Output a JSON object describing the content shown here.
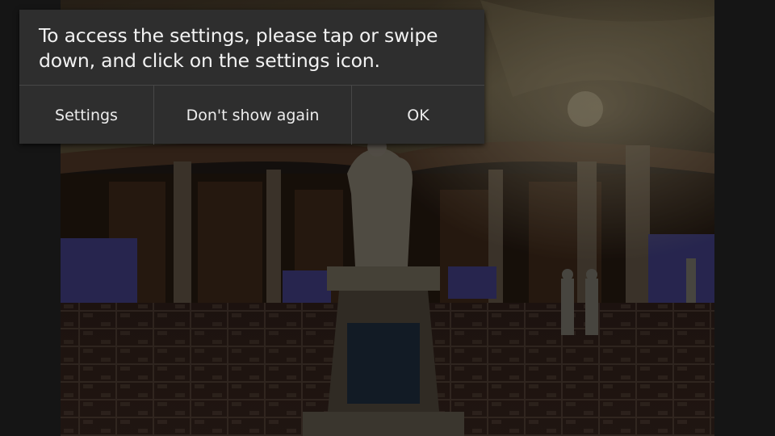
{
  "dialog": {
    "message": "To access the settings, please tap or swipe down, and click on the settings icon.",
    "buttons": {
      "settings": "Settings",
      "dont_show": "Don't show again",
      "ok": "OK"
    }
  },
  "colors": {
    "dialog_bg": "#2e2e2e",
    "divider": "#474747",
    "text": "#f2f2f2",
    "backdrop": "#151515"
  }
}
